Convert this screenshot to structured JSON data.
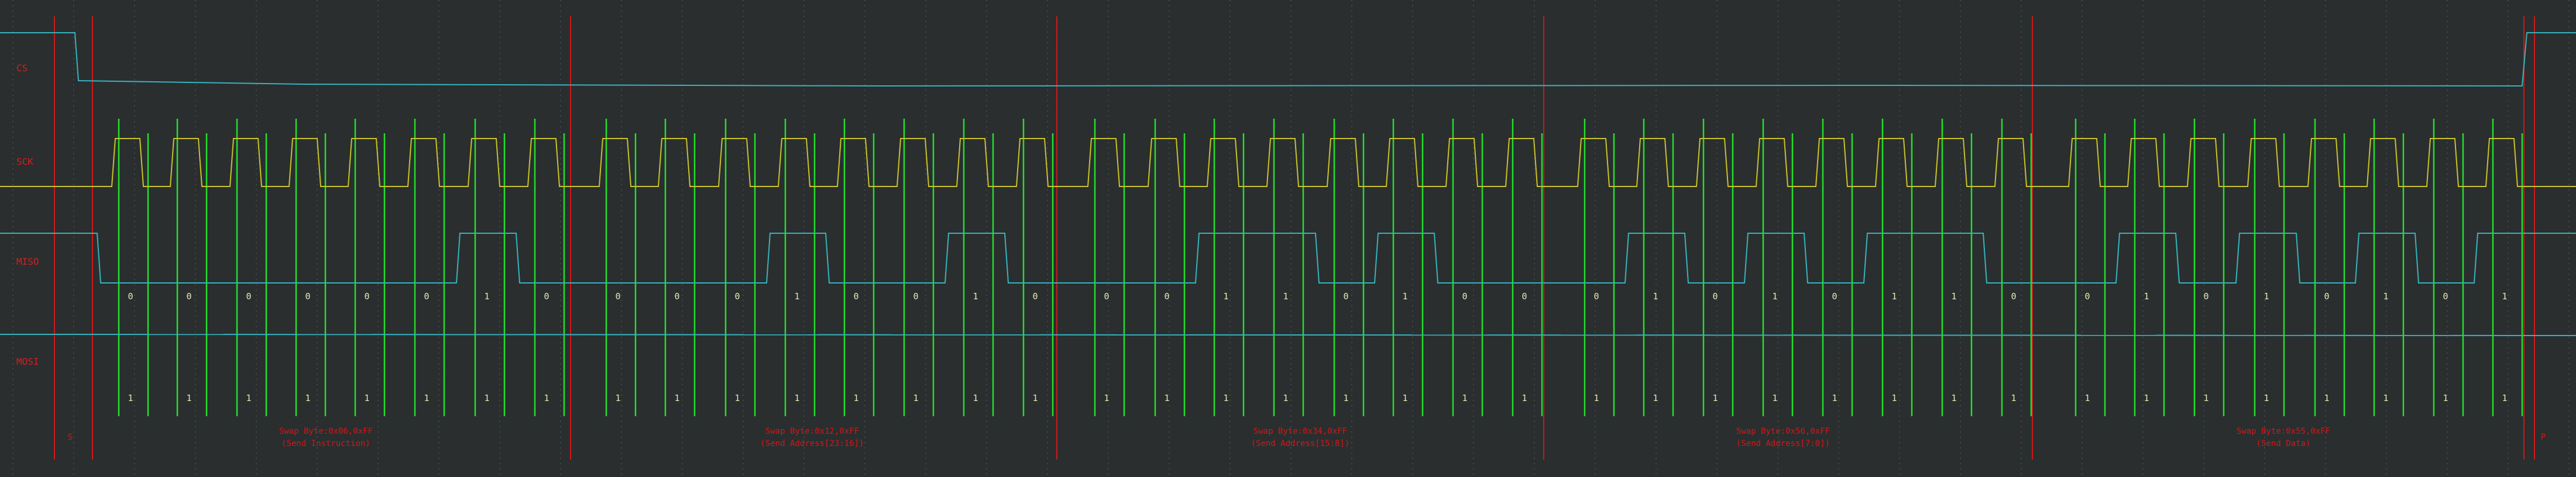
{
  "colors": {
    "background": "#2a2e2f",
    "grid": "#5a6062",
    "marker": "#d01818",
    "label": "#d02020",
    "cs_trace": "#37b3bd",
    "sck_trace": "#c8c22a",
    "miso_trace": "#37b3bd",
    "mosi_trace": "#37b3bd",
    "sample_line": "#22e02a",
    "bit_text": "#e8e8b0"
  },
  "channels": [
    {
      "key": "cs",
      "label": "CS"
    },
    {
      "key": "sck",
      "label": "SCK"
    },
    {
      "key": "miso",
      "label": "MISO"
    },
    {
      "key": "mosi",
      "label": "MOSI"
    }
  ],
  "frame_markers": {
    "start": "S",
    "stop": "P"
  },
  "bytes": [
    {
      "line1": "Swap Byte:0x06,0xFF",
      "line2": "(Send Instruction)",
      "miso_bits": [
        "0",
        "0",
        "0",
        "0",
        "0",
        "0",
        "1",
        "0"
      ],
      "mosi_bits": [
        "1",
        "1",
        "1",
        "1",
        "1",
        "1",
        "1",
        "1"
      ]
    },
    {
      "line1": "Swap Byte:0x12,0xFF",
      "line2": "(Send Address[23:16])",
      "miso_bits": [
        "0",
        "0",
        "0",
        "1",
        "0",
        "0",
        "1",
        "0"
      ],
      "mosi_bits": [
        "1",
        "1",
        "1",
        "1",
        "1",
        "1",
        "1",
        "1"
      ]
    },
    {
      "line1": "Swap Byte:0x34,0xFF",
      "line2": "(Send Address[15:8])",
      "miso_bits": [
        "0",
        "0",
        "1",
        "1",
        "0",
        "1",
        "0",
        "0"
      ],
      "mosi_bits": [
        "1",
        "1",
        "1",
        "1",
        "1",
        "1",
        "1",
        "1"
      ]
    },
    {
      "line1": "Swap Byte:0x56,0xFF",
      "line2": "(Send Address[7:0])",
      "miso_bits": [
        "0",
        "1",
        "0",
        "1",
        "0",
        "1",
        "1",
        "0"
      ],
      "mosi_bits": [
        "1",
        "1",
        "1",
        "1",
        "1",
        "1",
        "1",
        "1"
      ]
    },
    {
      "line1": "Swap Byte:0x55,0xFF",
      "line2": "(Send Data)",
      "miso_bits": [
        "0",
        "1",
        "0",
        "1",
        "0",
        "1",
        "0",
        "1"
      ],
      "mosi_bits": [
        "1",
        "1",
        "1",
        "1",
        "1",
        "1",
        "1",
        "1"
      ]
    }
  ]
}
